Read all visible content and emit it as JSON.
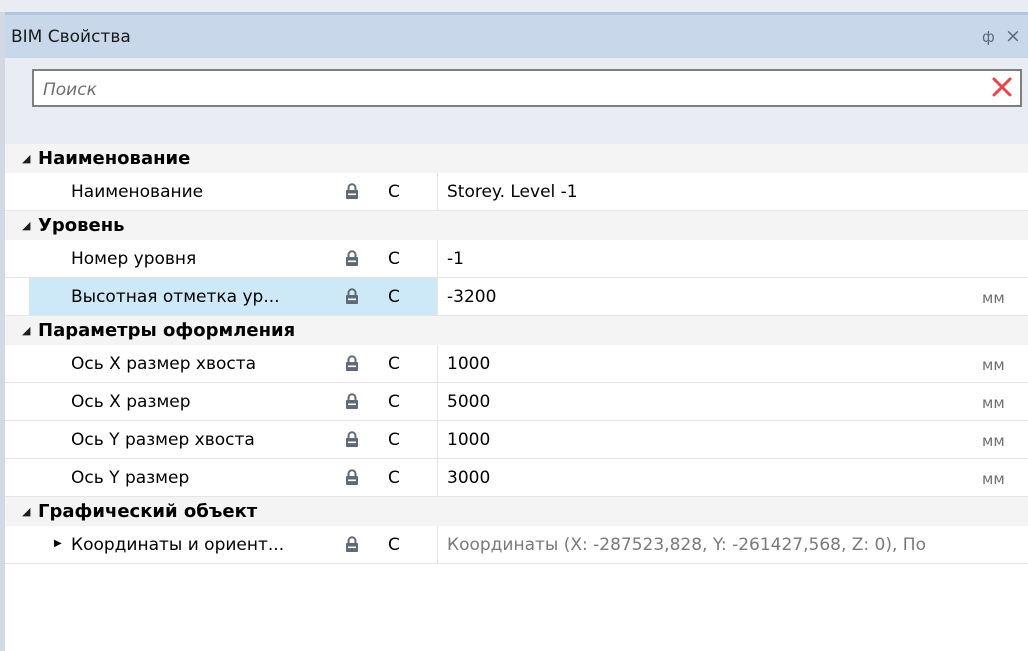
{
  "panel": {
    "title": "BIM Свойства",
    "pin_glyph": "ф",
    "close_glyph": "×"
  },
  "search": {
    "placeholder": "Поиск",
    "value": ""
  },
  "categories": [
    {
      "label": "Наименование",
      "rows": [
        {
          "name": "Наименование",
          "code": "С",
          "value": "Storey. Level -1",
          "unit": ""
        }
      ]
    },
    {
      "label": "Уровень",
      "rows": [
        {
          "name": "Номер уровня",
          "code": "С",
          "value": "-1",
          "unit": ""
        },
        {
          "name": "Высотная отметка ур...",
          "code": "С",
          "value": "-3200",
          "unit": "мм"
        }
      ]
    },
    {
      "label": "Параметры оформления",
      "rows": [
        {
          "name": "Ось X размер хвоста",
          "code": "С",
          "value": "1000",
          "unit": "мм"
        },
        {
          "name": "Ось X размер",
          "code": "С",
          "value": "5000",
          "unit": "мм"
        },
        {
          "name": "Ось Y размер хвоста",
          "code": "С",
          "value": "1000",
          "unit": "мм"
        },
        {
          "name": "Ось Y размер",
          "code": "С",
          "value": "3000",
          "unit": "мм"
        }
      ]
    },
    {
      "label": "Графический объект",
      "rows": [
        {
          "name": "Координаты и ориент...",
          "code": "С",
          "value": "Координаты (X: -287523,828, Y: -261427,568, Z: 0), По",
          "unit": ""
        }
      ]
    }
  ],
  "colors": {
    "titlebar": "#c8d7ea",
    "selected_row": "#cde8f7",
    "clear_icon": "#e8454a"
  }
}
